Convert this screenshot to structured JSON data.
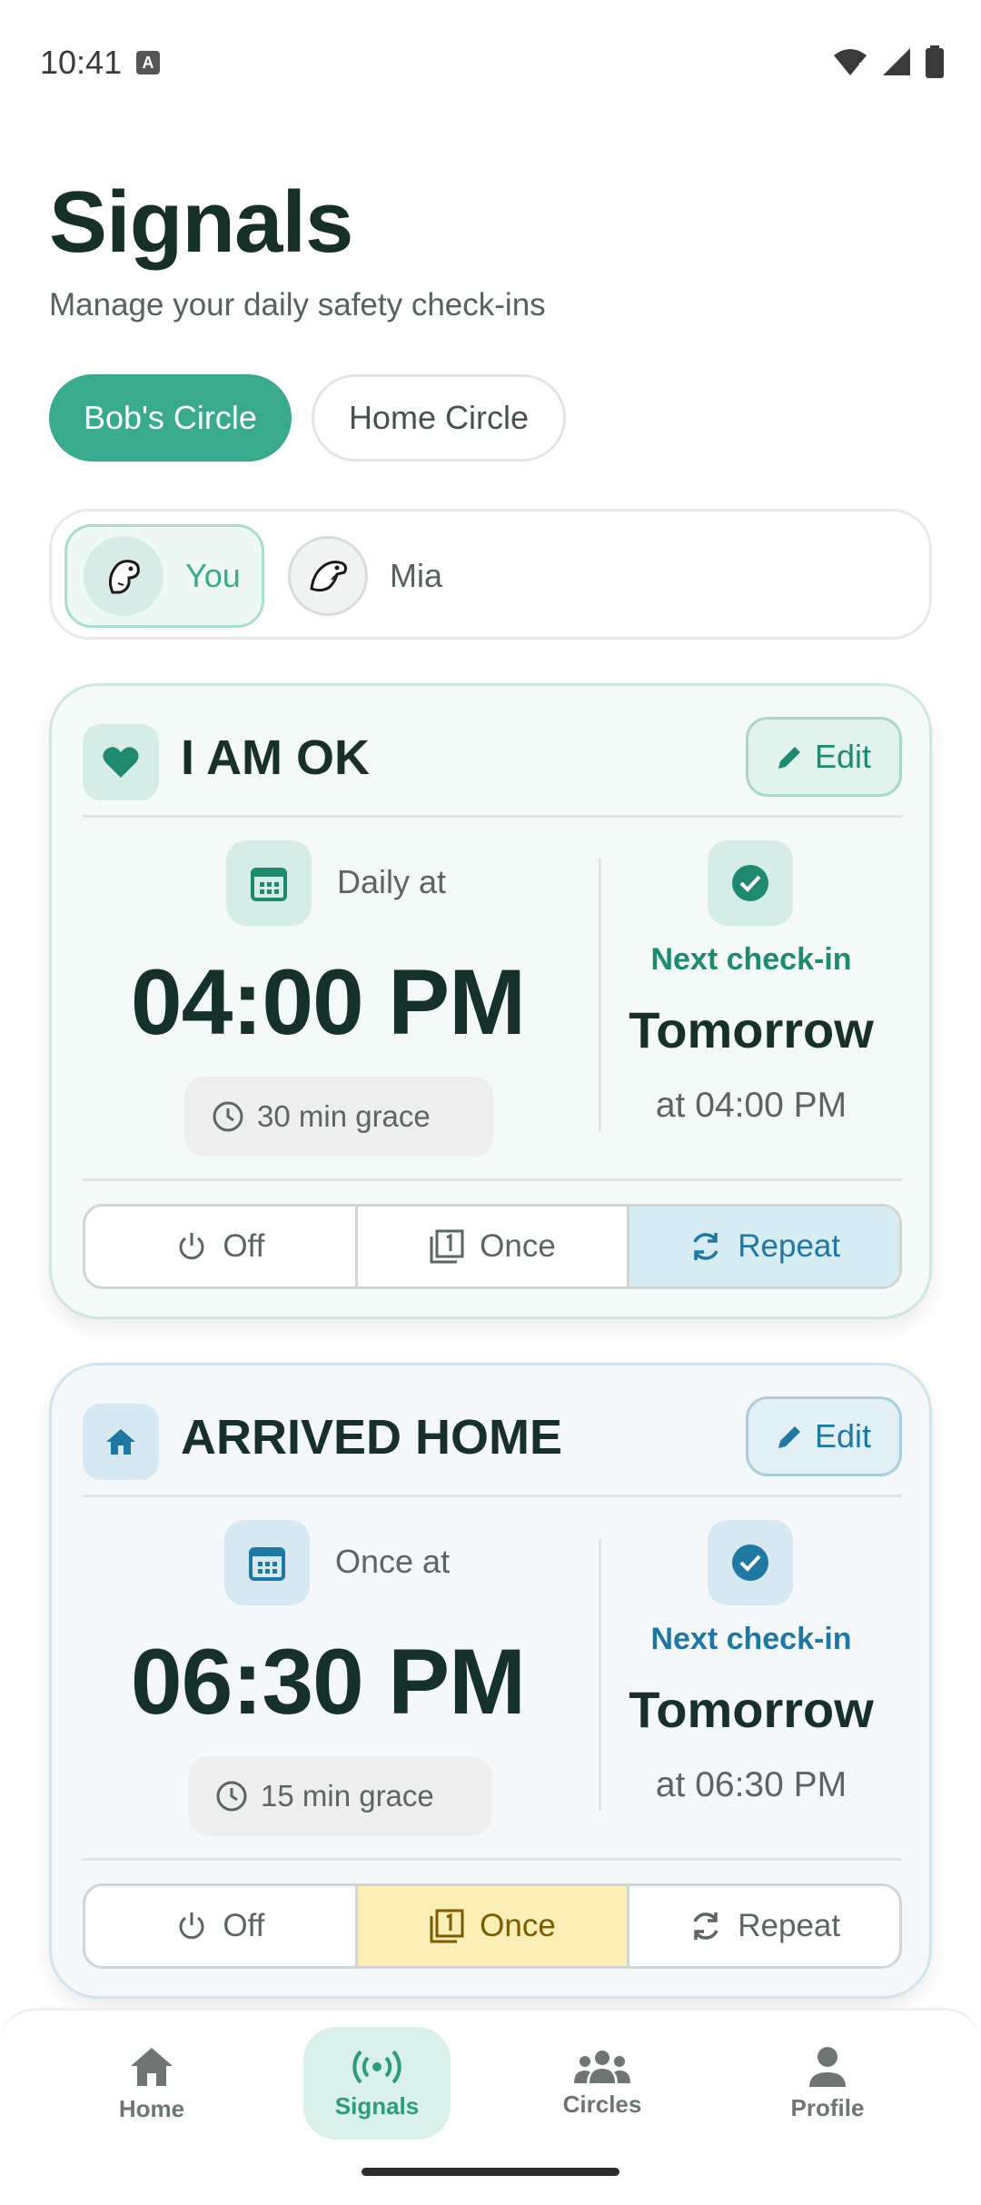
{
  "status_bar": {
    "time": "10:41",
    "a_icon": "A"
  },
  "header": {
    "title": "Signals",
    "subtitle": "Manage your daily safety check-ins"
  },
  "circles": [
    {
      "label": "Bob's Circle",
      "active": true
    },
    {
      "label": "Home Circle",
      "active": false
    }
  ],
  "members": [
    {
      "label": "You",
      "selected": true
    },
    {
      "label": "Mia",
      "selected": false
    }
  ],
  "signals": [
    {
      "title": "I AM OK",
      "edit_label": "Edit",
      "schedule_label": "Daily at",
      "time": "04:00 PM",
      "grace": "30 min grace",
      "next_label": "Next check-in",
      "next_day": "Tomorrow",
      "next_time": "at 04:00 PM",
      "modes": [
        "Off",
        "Once",
        "Repeat"
      ],
      "active_mode": "Repeat",
      "accent": "#1f8a6f"
    },
    {
      "title": "ARRIVED HOME",
      "edit_label": "Edit",
      "schedule_label": "Once at",
      "time": "06:30 PM",
      "grace": "15 min grace",
      "next_label": "Next check-in",
      "next_day": "Tomorrow",
      "next_time": "at 06:30 PM",
      "modes": [
        "Off",
        "Once",
        "Repeat"
      ],
      "active_mode": "Once",
      "accent": "#1f78a2"
    }
  ],
  "nav": [
    {
      "label": "Home",
      "icon": "home-icon",
      "active": false
    },
    {
      "label": "Signals",
      "icon": "signal-icon",
      "active": true
    },
    {
      "label": "Circles",
      "icon": "group-icon",
      "active": false
    },
    {
      "label": "Profile",
      "icon": "person-icon",
      "active": false
    }
  ]
}
